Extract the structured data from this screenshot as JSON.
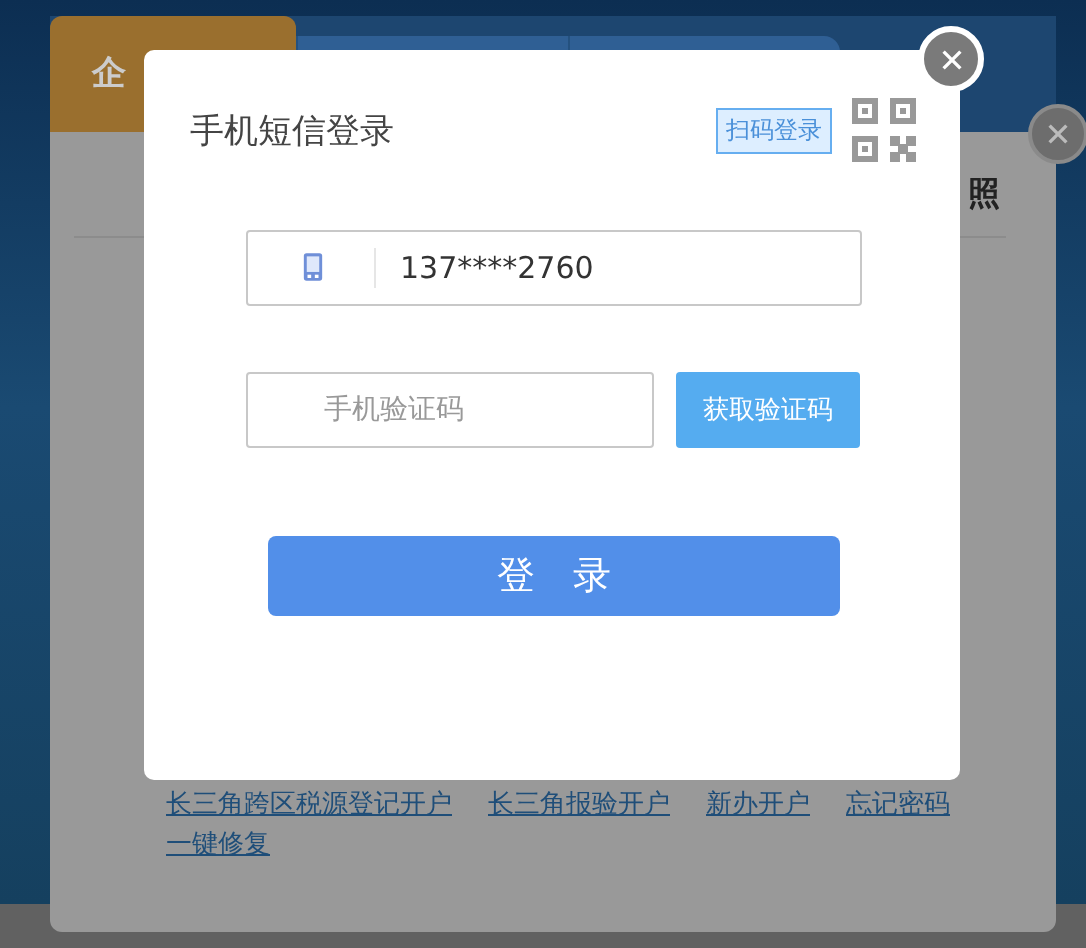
{
  "page": {
    "tabs": [
      {
        "label": "企",
        "selected": true
      }
    ],
    "column_heading": "照",
    "links": [
      "长三角跨区税源登记开户",
      "长三角报验开户",
      "新办开户",
      "忘记密码",
      "一键修复"
    ]
  },
  "dialog": {
    "title": "手机短信登录",
    "qr_login_label": "扫码登录",
    "phone_value": "137****2760",
    "code_placeholder": "手机验证码",
    "get_code_button": "获取验证码",
    "login_button": "登　录"
  }
}
